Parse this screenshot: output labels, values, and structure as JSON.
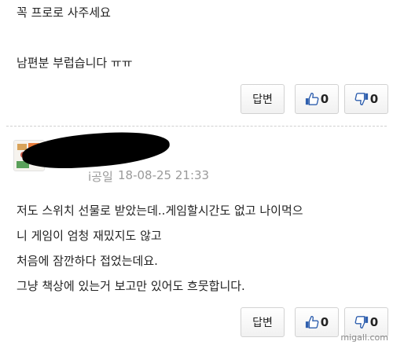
{
  "comment_1": {
    "lines": [
      "꼭 프로로 사주세요",
      "남편분 부럽습니다 ㅠㅠ"
    ],
    "reply_label": "답변",
    "like_count": "0",
    "dislike_count": "0"
  },
  "comment_2": {
    "author_partial": "i공일",
    "date": "18-08-25 21:33",
    "lines": [
      "저도 스위치 선물로 받았는데..게임할시간도 없고 나이먹으",
      "니 게임이 엄청 재밌지도 않고",
      "처음에 잠깐하다 접었는데요.",
      "그냥 책상에 있는거 보고만 있어도 흐뭇합니다."
    ],
    "reply_label": "답변",
    "like_count": "0",
    "dislike_count": "0"
  },
  "watermark": "migall.com",
  "colors": {
    "thumb_blue": "#2f5fae",
    "border": "#d2d2d2",
    "meta_gray": "#9a9a9a"
  }
}
